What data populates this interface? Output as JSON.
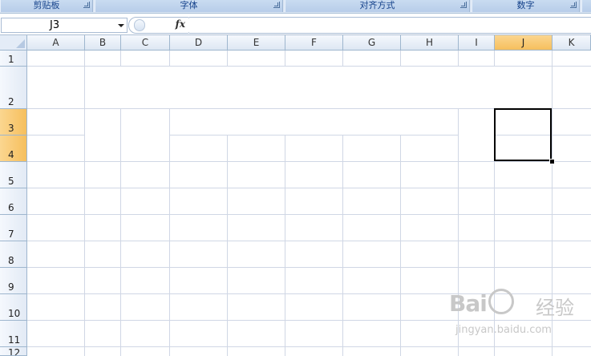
{
  "ribbon": {
    "groups": [
      {
        "label": "剪贴板"
      },
      {
        "label": "字体"
      },
      {
        "label": "对齐方式"
      },
      {
        "label": "数字"
      }
    ]
  },
  "formula_bar": {
    "name_box_value": "J3",
    "fx_label": "fx",
    "formula_value": ""
  },
  "sheet": {
    "columns": [
      "A",
      "B",
      "C",
      "D",
      "E",
      "F",
      "G",
      "H",
      "I",
      "J",
      "K"
    ],
    "rows": [
      "1",
      "2",
      "3",
      "4",
      "5",
      "6",
      "7",
      "8",
      "9",
      "10",
      "11",
      "12"
    ],
    "selected_column": "J",
    "selected_rows": [
      "3",
      "4"
    ],
    "active_cell": "J3"
  },
  "watermark": {
    "brand": "Bai",
    "brand_suffix": "du",
    "jingyan": "经验",
    "url": "jingyan.baidu.com"
  },
  "colors": {
    "selection_header": "#f6bf5d",
    "gridline": "#d0d7e5",
    "header_border": "#9eb6ce",
    "ribbon_text": "#15428b"
  }
}
